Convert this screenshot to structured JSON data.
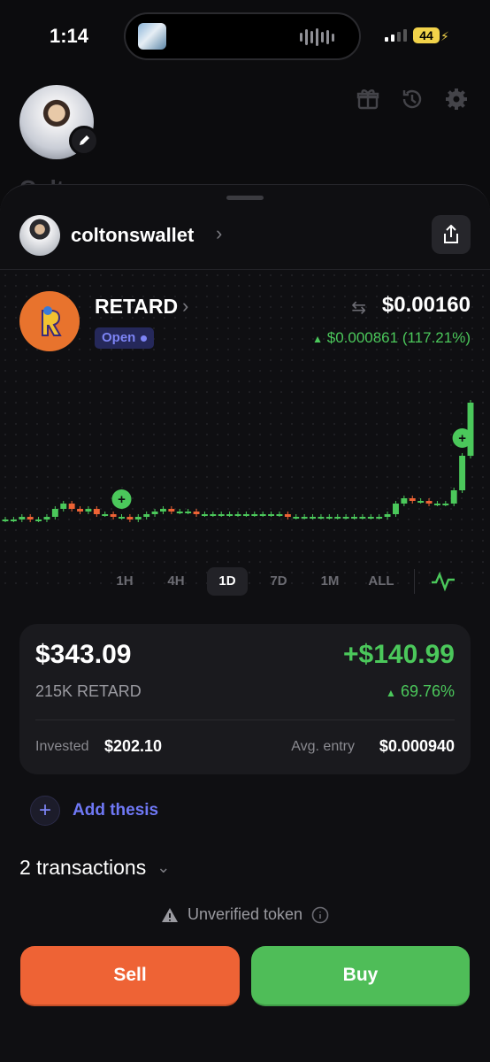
{
  "status_bar": {
    "time": "1:14",
    "battery": "44"
  },
  "profile": {
    "name_partial": "Colton"
  },
  "wallet": {
    "name": "coltonswallet"
  },
  "token": {
    "symbol": "RETARD",
    "status": "Open",
    "price": "$0.00160",
    "change": "$0.000861 (117.21%)",
    "logo_letter": "R"
  },
  "timeframes": [
    "1H",
    "4H",
    "1D",
    "7D",
    "1M",
    "ALL"
  ],
  "active_timeframe": "1D",
  "position": {
    "value": "$343.09",
    "pnl": "+$140.99",
    "amount": "215K RETARD",
    "pnl_pct": "69.76%",
    "invested_label": "Invested",
    "invested_value": "$202.10",
    "avg_label": "Avg. entry",
    "avg_value": "$0.000940"
  },
  "thesis": {
    "label": "Add thesis"
  },
  "transactions": {
    "label": "2 transactions"
  },
  "warning": {
    "label": "Unverified token"
  },
  "actions": {
    "sell": "Sell",
    "buy": "Buy"
  },
  "colors": {
    "green": "#4bc85b",
    "red": "#ee6335",
    "accent": "#6f78f5",
    "token_bg": "#e8732d"
  },
  "chart_data": {
    "type": "line",
    "title": "",
    "xlabel": "",
    "ylabel": "",
    "y_units": "relative price",
    "series": [
      {
        "values": [
          0.56,
          0.56,
          0.57,
          0.56,
          0.56,
          0.57,
          0.6,
          0.62,
          0.6,
          0.59,
          0.6,
          0.58,
          0.58,
          0.57,
          0.57,
          0.56,
          0.57,
          0.58,
          0.59,
          0.6,
          0.59,
          0.59,
          0.59,
          0.58,
          0.58,
          0.58,
          0.58,
          0.58,
          0.58,
          0.58,
          0.58,
          0.58,
          0.58,
          0.58,
          0.57,
          0.57,
          0.57,
          0.57,
          0.57,
          0.57,
          0.57,
          0.57,
          0.57,
          0.57,
          0.57,
          0.57,
          0.58,
          0.62,
          0.64,
          0.63,
          0.63,
          0.62,
          0.62,
          0.62,
          0.67,
          0.8,
          1.0
        ]
      }
    ],
    "buy_markers": [
      {
        "index": 14
      },
      {
        "index": 55
      }
    ]
  }
}
